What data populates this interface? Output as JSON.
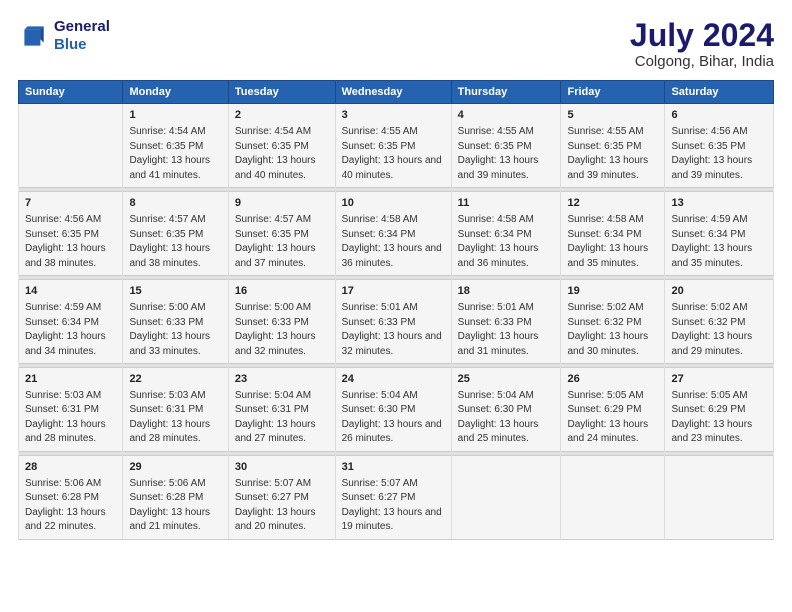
{
  "logo": {
    "line1": "General",
    "line2": "Blue"
  },
  "title": "July 2024",
  "subtitle": "Colgong, Bihar, India",
  "days": [
    "Sunday",
    "Monday",
    "Tuesday",
    "Wednesday",
    "Thursday",
    "Friday",
    "Saturday"
  ],
  "weeks": [
    [
      {
        "day": "",
        "sunrise": "",
        "sunset": "",
        "daylight": ""
      },
      {
        "day": "1",
        "sunrise": "Sunrise: 4:54 AM",
        "sunset": "Sunset: 6:35 PM",
        "daylight": "Daylight: 13 hours and 41 minutes."
      },
      {
        "day": "2",
        "sunrise": "Sunrise: 4:54 AM",
        "sunset": "Sunset: 6:35 PM",
        "daylight": "Daylight: 13 hours and 40 minutes."
      },
      {
        "day": "3",
        "sunrise": "Sunrise: 4:55 AM",
        "sunset": "Sunset: 6:35 PM",
        "daylight": "Daylight: 13 hours and 40 minutes."
      },
      {
        "day": "4",
        "sunrise": "Sunrise: 4:55 AM",
        "sunset": "Sunset: 6:35 PM",
        "daylight": "Daylight: 13 hours and 39 minutes."
      },
      {
        "day": "5",
        "sunrise": "Sunrise: 4:55 AM",
        "sunset": "Sunset: 6:35 PM",
        "daylight": "Daylight: 13 hours and 39 minutes."
      },
      {
        "day": "6",
        "sunrise": "Sunrise: 4:56 AM",
        "sunset": "Sunset: 6:35 PM",
        "daylight": "Daylight: 13 hours and 39 minutes."
      }
    ],
    [
      {
        "day": "7",
        "sunrise": "Sunrise: 4:56 AM",
        "sunset": "Sunset: 6:35 PM",
        "daylight": "Daylight: 13 hours and 38 minutes."
      },
      {
        "day": "8",
        "sunrise": "Sunrise: 4:57 AM",
        "sunset": "Sunset: 6:35 PM",
        "daylight": "Daylight: 13 hours and 38 minutes."
      },
      {
        "day": "9",
        "sunrise": "Sunrise: 4:57 AM",
        "sunset": "Sunset: 6:35 PM",
        "daylight": "Daylight: 13 hours and 37 minutes."
      },
      {
        "day": "10",
        "sunrise": "Sunrise: 4:58 AM",
        "sunset": "Sunset: 6:34 PM",
        "daylight": "Daylight: 13 hours and 36 minutes."
      },
      {
        "day": "11",
        "sunrise": "Sunrise: 4:58 AM",
        "sunset": "Sunset: 6:34 PM",
        "daylight": "Daylight: 13 hours and 36 minutes."
      },
      {
        "day": "12",
        "sunrise": "Sunrise: 4:58 AM",
        "sunset": "Sunset: 6:34 PM",
        "daylight": "Daylight: 13 hours and 35 minutes."
      },
      {
        "day": "13",
        "sunrise": "Sunrise: 4:59 AM",
        "sunset": "Sunset: 6:34 PM",
        "daylight": "Daylight: 13 hours and 35 minutes."
      }
    ],
    [
      {
        "day": "14",
        "sunrise": "Sunrise: 4:59 AM",
        "sunset": "Sunset: 6:34 PM",
        "daylight": "Daylight: 13 hours and 34 minutes."
      },
      {
        "day": "15",
        "sunrise": "Sunrise: 5:00 AM",
        "sunset": "Sunset: 6:33 PM",
        "daylight": "Daylight: 13 hours and 33 minutes."
      },
      {
        "day": "16",
        "sunrise": "Sunrise: 5:00 AM",
        "sunset": "Sunset: 6:33 PM",
        "daylight": "Daylight: 13 hours and 32 minutes."
      },
      {
        "day": "17",
        "sunrise": "Sunrise: 5:01 AM",
        "sunset": "Sunset: 6:33 PM",
        "daylight": "Daylight: 13 hours and 32 minutes."
      },
      {
        "day": "18",
        "sunrise": "Sunrise: 5:01 AM",
        "sunset": "Sunset: 6:33 PM",
        "daylight": "Daylight: 13 hours and 31 minutes."
      },
      {
        "day": "19",
        "sunrise": "Sunrise: 5:02 AM",
        "sunset": "Sunset: 6:32 PM",
        "daylight": "Daylight: 13 hours and 30 minutes."
      },
      {
        "day": "20",
        "sunrise": "Sunrise: 5:02 AM",
        "sunset": "Sunset: 6:32 PM",
        "daylight": "Daylight: 13 hours and 29 minutes."
      }
    ],
    [
      {
        "day": "21",
        "sunrise": "Sunrise: 5:03 AM",
        "sunset": "Sunset: 6:31 PM",
        "daylight": "Daylight: 13 hours and 28 minutes."
      },
      {
        "day": "22",
        "sunrise": "Sunrise: 5:03 AM",
        "sunset": "Sunset: 6:31 PM",
        "daylight": "Daylight: 13 hours and 28 minutes."
      },
      {
        "day": "23",
        "sunrise": "Sunrise: 5:04 AM",
        "sunset": "Sunset: 6:31 PM",
        "daylight": "Daylight: 13 hours and 27 minutes."
      },
      {
        "day": "24",
        "sunrise": "Sunrise: 5:04 AM",
        "sunset": "Sunset: 6:30 PM",
        "daylight": "Daylight: 13 hours and 26 minutes."
      },
      {
        "day": "25",
        "sunrise": "Sunrise: 5:04 AM",
        "sunset": "Sunset: 6:30 PM",
        "daylight": "Daylight: 13 hours and 25 minutes."
      },
      {
        "day": "26",
        "sunrise": "Sunrise: 5:05 AM",
        "sunset": "Sunset: 6:29 PM",
        "daylight": "Daylight: 13 hours and 24 minutes."
      },
      {
        "day": "27",
        "sunrise": "Sunrise: 5:05 AM",
        "sunset": "Sunset: 6:29 PM",
        "daylight": "Daylight: 13 hours and 23 minutes."
      }
    ],
    [
      {
        "day": "28",
        "sunrise": "Sunrise: 5:06 AM",
        "sunset": "Sunset: 6:28 PM",
        "daylight": "Daylight: 13 hours and 22 minutes."
      },
      {
        "day": "29",
        "sunrise": "Sunrise: 5:06 AM",
        "sunset": "Sunset: 6:28 PM",
        "daylight": "Daylight: 13 hours and 21 minutes."
      },
      {
        "day": "30",
        "sunrise": "Sunrise: 5:07 AM",
        "sunset": "Sunset: 6:27 PM",
        "daylight": "Daylight: 13 hours and 20 minutes."
      },
      {
        "day": "31",
        "sunrise": "Sunrise: 5:07 AM",
        "sunset": "Sunset: 6:27 PM",
        "daylight": "Daylight: 13 hours and 19 minutes."
      },
      {
        "day": "",
        "sunrise": "",
        "sunset": "",
        "daylight": ""
      },
      {
        "day": "",
        "sunrise": "",
        "sunset": "",
        "daylight": ""
      },
      {
        "day": "",
        "sunrise": "",
        "sunset": "",
        "daylight": ""
      }
    ]
  ]
}
